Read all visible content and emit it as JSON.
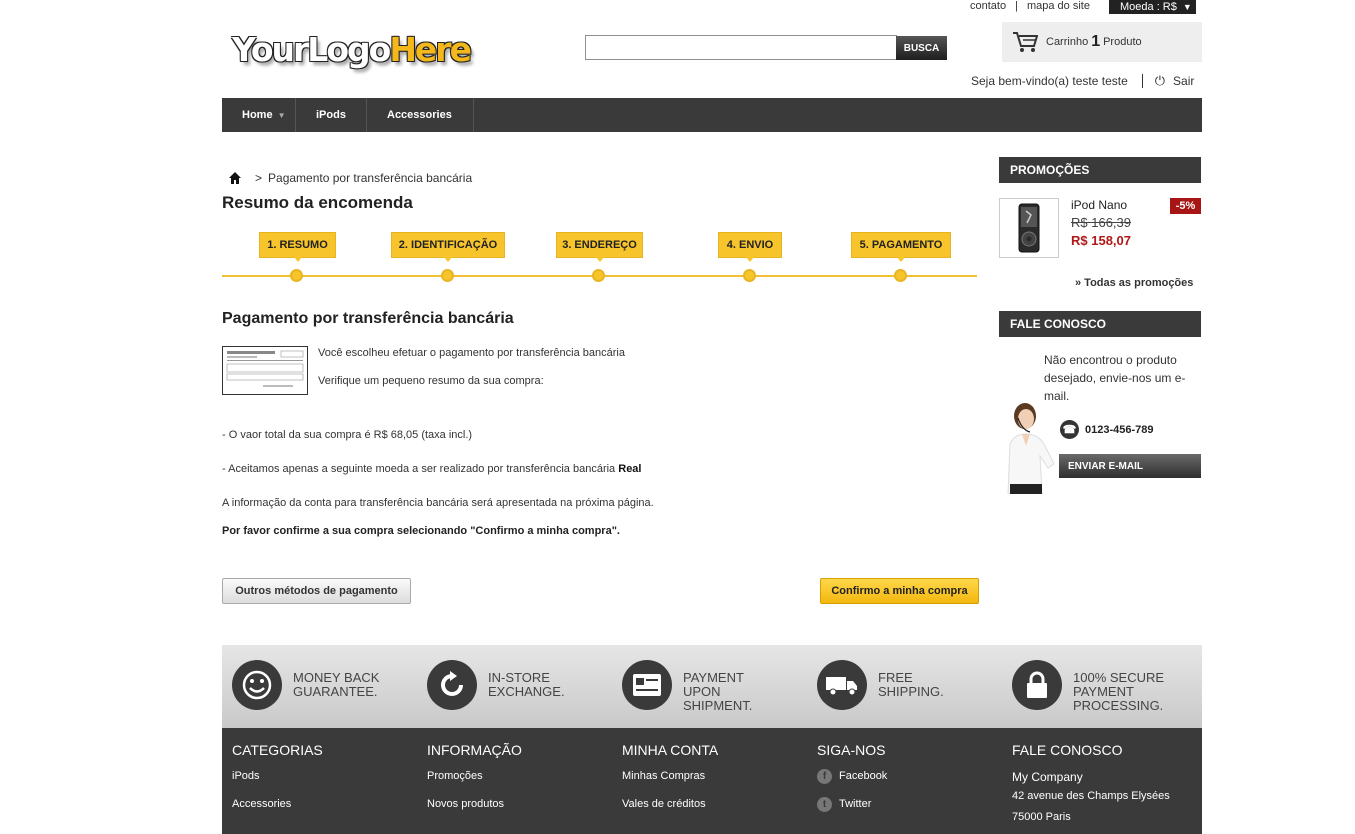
{
  "top_links": {
    "contact": "contato",
    "sitemap": "mapa do site"
  },
  "currency": {
    "label": "Moeda : R$"
  },
  "logo": {
    "part1": "YourLogo",
    "part2": "Here"
  },
  "search": {
    "placeholder": "",
    "button": "BUSCA"
  },
  "cart": {
    "label": "Carrinho",
    "count": "1",
    "unit": "Produto"
  },
  "user": {
    "welcome": "Seja bem-vindo(a) teste teste",
    "logout": "Sair"
  },
  "nav": {
    "home": "Home",
    "ipods": "iPods",
    "accessories": "Accessories"
  },
  "breadcrumb": {
    "sep": ">",
    "current": "Pagamento por transferência bancária"
  },
  "page_title": "Resumo da encomenda",
  "steps": [
    "1. RESUMO",
    "2. IDENTIFICAÇÃO",
    "3. ENDEREÇO",
    "4. ENVIO",
    "5. PAGAMENTO"
  ],
  "payment": {
    "title": "Pagamento por transferência bancária",
    "line1": "Você escolheu efetuar o pagamento por transferência bancária",
    "line2": "Verifique um pequeno resumo da sua compra:",
    "total": "- O vaor total da sua compra é R$ 68,05 (taxa incl.)",
    "currency_text": "- Aceitamos apenas a seguinte moeda a ser realizado por transferência bancária",
    "currency_value": "Real",
    "info": "A informação da conta para transferência bancária será apresentada na próxima página.",
    "confirm_note": "Por favor confirme a sua compra selecionando \"Confirmo a minha compra\".",
    "other_methods": "Outros métodos de pagamento",
    "confirm": "Confirmo a minha compra"
  },
  "promotions": {
    "title": "PROMOÇÕES",
    "product": "iPod Nano",
    "old_price": "R$ 166,39",
    "new_price": "R$ 158,07",
    "discount": "-5%",
    "all": "» Todas as promoções"
  },
  "contact_box": {
    "title": "FALE CONOSCO",
    "text": "Não encontrou o produto desejado, envie-nos um e-mail.",
    "phone": "0123-456-789",
    "email_button": "ENVIAR E-MAIL"
  },
  "features": [
    {
      "icon": "smiley-icon",
      "line1": "MONEY BACK",
      "line2": "GUARANTEE.",
      "line3": ""
    },
    {
      "icon": "refresh-icon",
      "line1": "IN-STORE",
      "line2": "EXCHANGE.",
      "line3": ""
    },
    {
      "icon": "credit-card-icon",
      "line1": "PAYMENT UPON",
      "line2": "SHIPMENT.",
      "line3": ""
    },
    {
      "icon": "truck-icon",
      "line1": "FREE SHIPPING.",
      "line2": "",
      "line3": ""
    },
    {
      "icon": "lock-icon",
      "line1": "100% SECURE",
      "line2": "PAYMENT",
      "line3": "PROCESSING."
    }
  ],
  "footer": {
    "categories": {
      "title": "CATEGORIAS",
      "items": [
        "iPods",
        "Accessories"
      ]
    },
    "info": {
      "title": "INFORMAÇÃO",
      "items": [
        "Promoções",
        "Novos produtos"
      ]
    },
    "account": {
      "title": "MINHA CONTA",
      "items": [
        "Minhas Compras",
        "Vales de créditos"
      ]
    },
    "social": {
      "title": "SIGA-NOS",
      "items": [
        "Facebook",
        "Twitter"
      ]
    },
    "contact": {
      "title": "FALE CONOSCO",
      "company": "My Company",
      "address1": "42 avenue des Champs Elysées",
      "address2": "75000 Paris"
    }
  },
  "colors": {
    "accent": "#f7c42b",
    "dark": "#3a3a3a",
    "price": "#b01818"
  }
}
